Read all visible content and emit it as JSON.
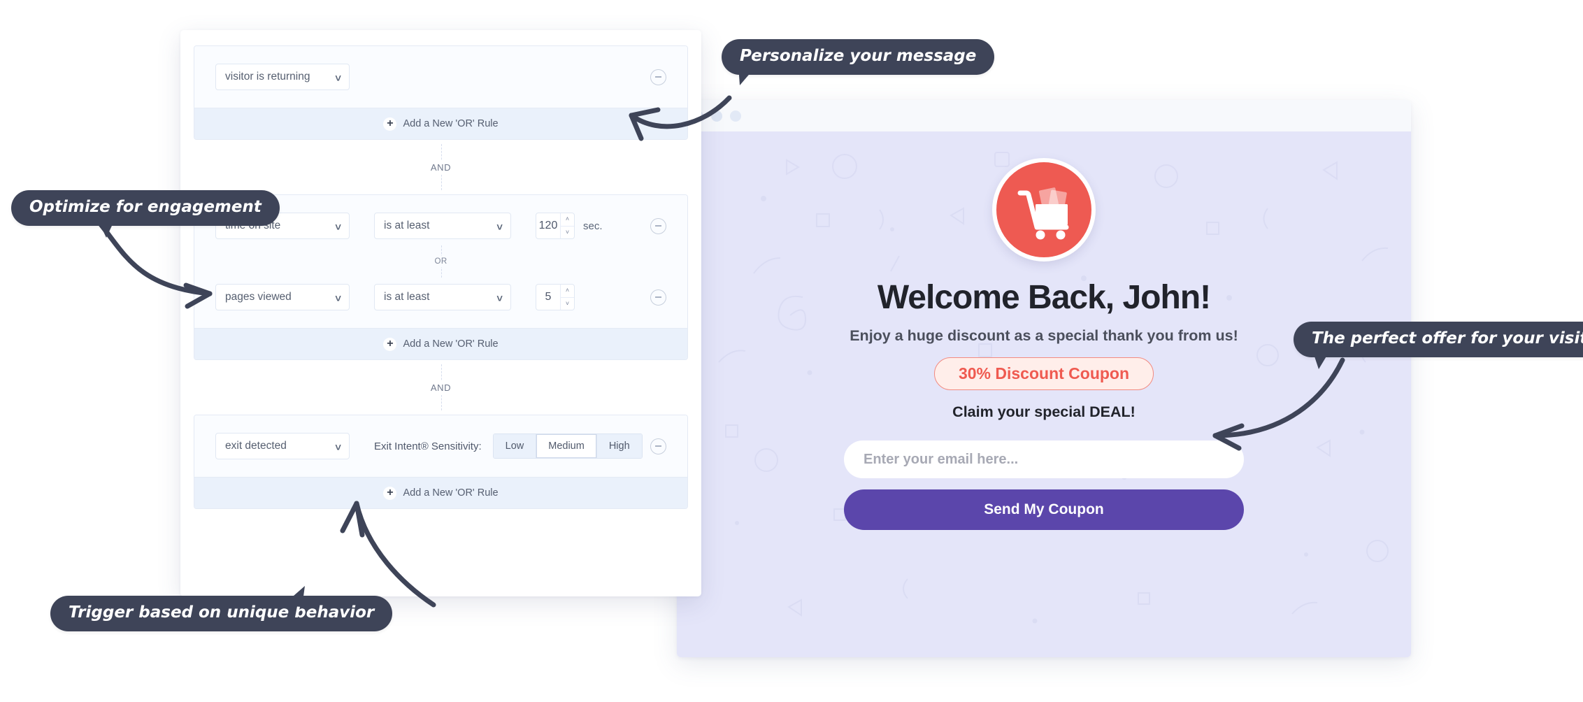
{
  "browser": {
    "dots": [
      "window-dot-1",
      "window-dot-2",
      "window-dot-3"
    ]
  },
  "popup": {
    "icon": "shopping-cart-icon",
    "headline": "Welcome Back, John!",
    "subheadline": "Enjoy a huge discount as a special thank you from us!",
    "coupon_label": "30% Discount Coupon",
    "claim_text": "Claim your special DEAL!",
    "email_placeholder": "Enter your email here...",
    "email_value": "",
    "submit_label": "Send My Coupon",
    "colors": {
      "background": "#e4e5f9",
      "cart_circle": "#ee5a52",
      "coupon_bg": "#ffeeea",
      "coupon_border": "#f28a80",
      "coupon_text": "#ef5a50",
      "submit_bg": "#5b46ab",
      "headline": "#21232b"
    }
  },
  "rules": {
    "groups": [
      {
        "name": "group-visitor",
        "rows": [
          {
            "condition": "visitor is returning",
            "operator": null,
            "value": null,
            "unit": null,
            "remove": "remove-rule"
          }
        ],
        "add_label": "Add a New 'OR' Rule"
      },
      {
        "name": "group-engagement",
        "rows": [
          {
            "condition": "time on site",
            "operator": "is at least",
            "value": "120",
            "unit": "sec.",
            "remove": "remove-rule"
          },
          {
            "condition": "pages viewed",
            "operator": "is at least",
            "value": "5",
            "unit": "",
            "remove": "remove-rule"
          }
        ],
        "or_label": "OR",
        "add_label": "Add a New 'OR' Rule"
      },
      {
        "name": "group-exit-intent",
        "rows": [
          {
            "condition": "exit detected",
            "sensitivity_label": "Exit Intent® Sensitivity:",
            "sensitivity_options": [
              "Low",
              "Medium",
              "High"
            ],
            "sensitivity_selected": "Medium",
            "remove": "remove-rule"
          }
        ],
        "add_label": "Add a New 'OR' Rule"
      }
    ],
    "and_label_1": "AND",
    "and_label_2": "AND"
  },
  "callouts": {
    "personalize": "Personalize your message",
    "optimize": "Optimize for engagement",
    "offer": "The perfect offer for your visitor",
    "trigger": "Trigger based on unique behavior"
  }
}
